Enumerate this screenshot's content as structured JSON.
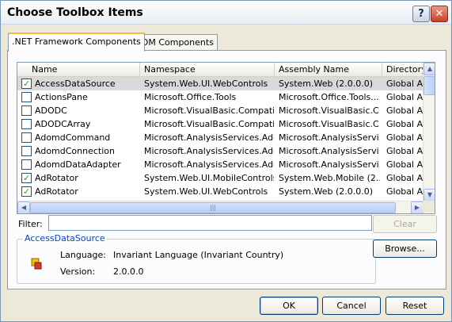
{
  "window": {
    "title": "Choose Toolbox Items"
  },
  "titlebar": {
    "help": "?",
    "close": "✕"
  },
  "tabs": [
    {
      "label": ".NET Framework Components",
      "active": true
    },
    {
      "label": "COM Components",
      "active": false
    }
  ],
  "list": {
    "columns": [
      "Name",
      "Namespace",
      "Assembly Name",
      "Directory"
    ],
    "rows": [
      {
        "checked": true,
        "selected": true,
        "name": "AccessDataSource",
        "namespace": "System.Web.UI.WebControls",
        "assembly": "System.Web (2.0.0.0)",
        "directory": "Global Ass"
      },
      {
        "checked": false,
        "selected": false,
        "name": "ActionsPane",
        "namespace": "Microsoft.Office.Tools",
        "assembly": "Microsoft.Office.Tools....",
        "directory": "Global Ass"
      },
      {
        "checked": false,
        "selected": false,
        "name": "ADODC",
        "namespace": "Microsoft.VisualBasic.Compatibi...",
        "assembly": "Microsoft.VisualBasic.C...",
        "directory": "Global Ass"
      },
      {
        "checked": false,
        "selected": false,
        "name": "ADODCArray",
        "namespace": "Microsoft.VisualBasic.Compatibi...",
        "assembly": "Microsoft.VisualBasic.C...",
        "directory": "Global Ass"
      },
      {
        "checked": false,
        "selected": false,
        "name": "AdomdCommand",
        "namespace": "Microsoft.AnalysisServices.Ado...",
        "assembly": "Microsoft.AnalysisServi...",
        "directory": "Global Ass"
      },
      {
        "checked": false,
        "selected": false,
        "name": "AdomdConnection",
        "namespace": "Microsoft.AnalysisServices.Ado...",
        "assembly": "Microsoft.AnalysisServi...",
        "directory": "Global Ass"
      },
      {
        "checked": false,
        "selected": false,
        "name": "AdomdDataAdapter",
        "namespace": "Microsoft.AnalysisServices.Ado...",
        "assembly": "Microsoft.AnalysisServi...",
        "directory": "Global Ass"
      },
      {
        "checked": true,
        "selected": false,
        "name": "AdRotator",
        "namespace": "System.Web.UI.MobileControls",
        "assembly": "System.Web.Mobile (2....",
        "directory": "Global Ass"
      },
      {
        "checked": true,
        "selected": false,
        "name": "AdRotator",
        "namespace": "System.Web.UI.WebControls",
        "assembly": "System.Web (2.0.0.0)",
        "directory": "Global Ass"
      }
    ]
  },
  "filter": {
    "label": "Filter:",
    "value": "",
    "clear": "Clear"
  },
  "details": {
    "group_title": "AccessDataSource",
    "language_label": "Language:",
    "language_value": "Invariant Language (Invariant Country)",
    "version_label": "Version:",
    "version_value": "2.0.0.0",
    "browse": "Browse..."
  },
  "footer": {
    "ok": "OK",
    "cancel": "Cancel",
    "reset": "Reset"
  }
}
